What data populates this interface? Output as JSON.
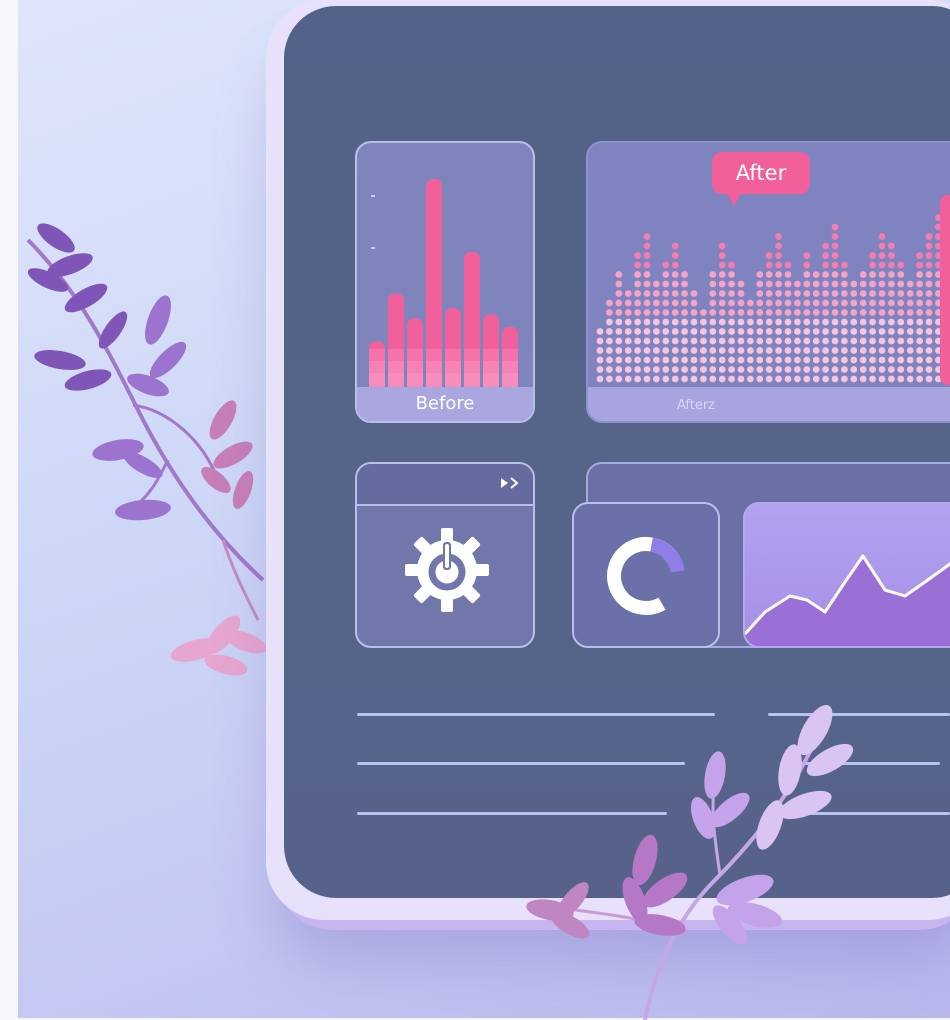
{
  "dashboard": {
    "before_panel": {
      "label": "Before",
      "levels": [
        0.22,
        0.45,
        0.33,
        1.0,
        0.38,
        0.65,
        0.35,
        0.29
      ]
    },
    "after_panel": {
      "badge_label": "After",
      "footer_label": "Afterz"
    },
    "colors": {
      "accent": "#f2609b",
      "screen": "#536288",
      "panel_border": "#b9bfe9",
      "line_fill": "#a58fe6"
    },
    "icons": {
      "settings": "gear-power-icon",
      "chart": "donut-chart-icon",
      "play": "play-next-icon"
    }
  }
}
